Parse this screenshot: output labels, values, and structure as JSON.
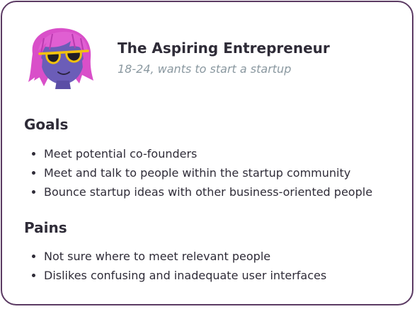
{
  "persona": {
    "title": "The Aspiring Entrepreneur",
    "subtitle": "18-24, wants to start a startup",
    "avatar_icon": "avatar-pink-hair-sunglasses",
    "colors": {
      "border": "#5b3a63",
      "hair": "#d94fc9",
      "face": "#6b5db8",
      "sunglasses": "#f3c20e",
      "subtitle": "#8a98a0"
    }
  },
  "goals": {
    "heading": "Goals",
    "items": [
      "Meet potential co-founders",
      "Meet and talk to people within the startup community",
      "Bounce startup ideas with other business-oriented people"
    ]
  },
  "pains": {
    "heading": "Pains",
    "items": [
      "Not sure where to meet relevant people",
      "Dislikes confusing and inadequate user interfaces"
    ]
  }
}
